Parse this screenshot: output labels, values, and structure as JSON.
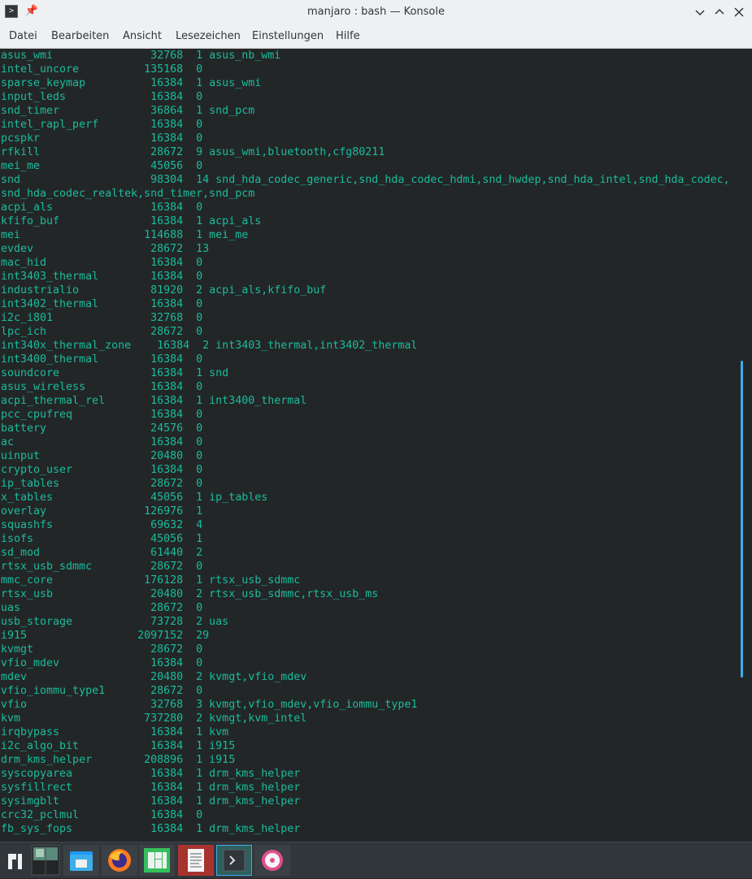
{
  "window": {
    "title": "manjaro : bash — Konsole",
    "controls": [
      "chevron-down-icon",
      "chevron-up-icon",
      "close-icon"
    ]
  },
  "menu": {
    "items": [
      "Datei",
      "Bearbeiten",
      "Ansicht",
      "Lesezeichen",
      "Einstellungen",
      "Hilfe"
    ]
  },
  "terminal": {
    "lines": [
      "asus_wmi               32768  1 asus_nb_wmi",
      "intel_uncore          135168  0",
      "sparse_keymap          16384  1 asus_wmi",
      "input_leds             16384  0",
      "snd_timer              36864  1 snd_pcm",
      "intel_rapl_perf        16384  0",
      "pcspkr                 16384  0",
      "rfkill                 28672  9 asus_wmi,bluetooth,cfg80211",
      "mei_me                 45056  0",
      "snd                    98304  14 snd_hda_codec_generic,snd_hda_codec_hdmi,snd_hwdep,snd_hda_intel,snd_hda_codec,",
      "snd_hda_codec_realtek,snd_timer,snd_pcm",
      "acpi_als               16384  0",
      "kfifo_buf              16384  1 acpi_als",
      "mei                   114688  1 mei_me",
      "evdev                  28672  13",
      "mac_hid                16384  0",
      "int3403_thermal        16384  0",
      "industrialio           81920  2 acpi_als,kfifo_buf",
      "int3402_thermal        16384  0",
      "i2c_i801               32768  0",
      "lpc_ich                28672  0",
      "int340x_thermal_zone    16384  2 int3403_thermal,int3402_thermal",
      "int3400_thermal        16384  0",
      "soundcore              16384  1 snd",
      "asus_wireless          16384  0",
      "acpi_thermal_rel       16384  1 int3400_thermal",
      "pcc_cpufreq            16384  0",
      "battery                24576  0",
      "ac                     16384  0",
      "uinput                 20480  0",
      "crypto_user            16384  0",
      "ip_tables              28672  0",
      "x_tables               45056  1 ip_tables",
      "overlay               126976  1",
      "squashfs               69632  4",
      "isofs                  45056  1",
      "sd_mod                 61440  2",
      "rtsx_usb_sdmmc         28672  0",
      "mmc_core              176128  1 rtsx_usb_sdmmc",
      "rtsx_usb               20480  2 rtsx_usb_sdmmc,rtsx_usb_ms",
      "uas                    28672  0",
      "usb_storage            73728  2 uas",
      "i915                 2097152  29",
      "kvmgt                  28672  0",
      "vfio_mdev              16384  0",
      "mdev                   20480  2 kvmgt,vfio_mdev",
      "vfio_iommu_type1       28672  0",
      "vfio                   32768  3 kvmgt,vfio_mdev,vfio_iommu_type1",
      "kvm                   737280  2 kvmgt,kvm_intel",
      "irqbypass              16384  1 kvm",
      "i2c_algo_bit           16384  1 i915",
      "drm_kms_helper        208896  1 i915",
      "syscopyarea            16384  1 drm_kms_helper",
      "sysfillrect            16384  1 drm_kms_helper",
      "sysimgblt              16384  1 drm_kms_helper",
      "crc32_pclmul           16384  0",
      "fb_sys_fops            16384  1 drm_kms_helper"
    ],
    "text_color": "#1abc9c",
    "background": "#232627"
  },
  "taskbar": {
    "items": [
      {
        "name": "application-launcher-icon"
      },
      {
        "name": "pager-icon"
      },
      {
        "name": "file-manager-icon"
      },
      {
        "name": "firefox-icon"
      },
      {
        "name": "manjaro-settings-icon"
      },
      {
        "name": "text-editor-icon"
      },
      {
        "name": "konsole-icon"
      },
      {
        "name": "media-player-icon"
      }
    ]
  },
  "colors": {
    "accent": "#3daee9",
    "terminal_text": "#1abc9c",
    "panel": "#31363b"
  }
}
